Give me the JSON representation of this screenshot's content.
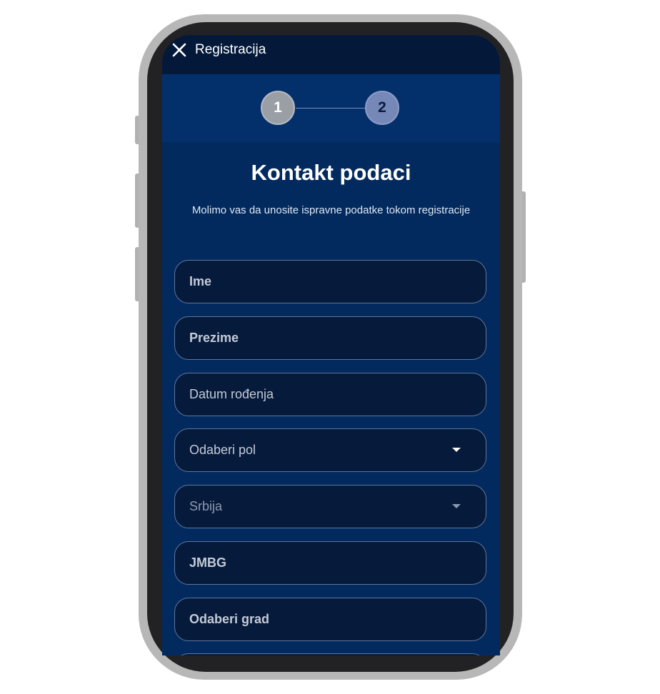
{
  "header": {
    "title": "Registracija",
    "close_icon": "close-icon"
  },
  "stepper": {
    "steps": [
      {
        "label": "1",
        "state": "completed"
      },
      {
        "label": "2",
        "state": "current"
      }
    ]
  },
  "main": {
    "title": "Kontakt podaci",
    "subtitle": "Molimo vas da unosite ispravne podatke tokom registracije"
  },
  "form": {
    "first_name": {
      "placeholder": "Ime",
      "value": ""
    },
    "last_name": {
      "placeholder": "Prezime",
      "value": ""
    },
    "birth_date": {
      "placeholder": "Datum rođenja",
      "value": ""
    },
    "gender": {
      "placeholder": "Odaberi pol",
      "value": ""
    },
    "country": {
      "value": "Srbija",
      "disabled": true
    },
    "jmbg": {
      "placeholder": "JMBG",
      "value": ""
    },
    "city": {
      "placeholder": "Odaberi grad",
      "value": ""
    }
  },
  "colors": {
    "screen_background": "#022a5e",
    "topbar_background": "#04193a",
    "stepper_background": "#032f6b",
    "field_background": "#061a3b",
    "field_border": "#5f7599",
    "step_completed": "#9a9fa6",
    "step_current": "#7588b8"
  }
}
